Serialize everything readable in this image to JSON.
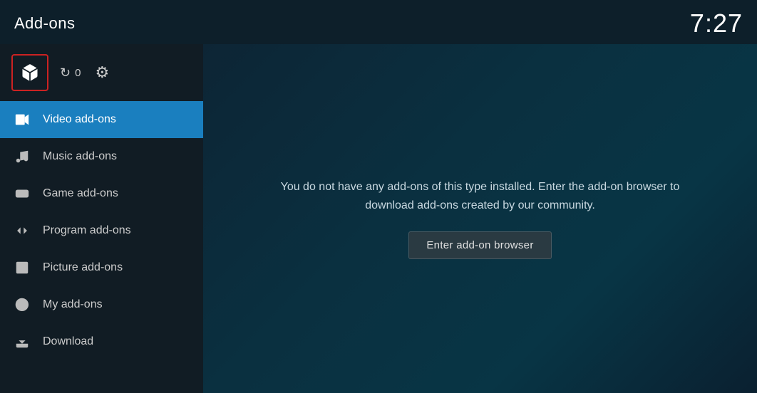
{
  "header": {
    "title": "Add-ons",
    "time": "7:27"
  },
  "toolbar": {
    "update_count": "0"
  },
  "nav": {
    "items": [
      {
        "id": "video-addons",
        "label": "Video add-ons",
        "icon": "video",
        "active": true
      },
      {
        "id": "music-addons",
        "label": "Music add-ons",
        "icon": "music",
        "active": false
      },
      {
        "id": "game-addons",
        "label": "Game add-ons",
        "icon": "game",
        "active": false
      },
      {
        "id": "program-addons",
        "label": "Program add-ons",
        "icon": "program",
        "active": false
      },
      {
        "id": "picture-addons",
        "label": "Picture add-ons",
        "icon": "picture",
        "active": false
      },
      {
        "id": "my-addons",
        "label": "My add-ons",
        "icon": "myaddon",
        "active": false
      },
      {
        "id": "download",
        "label": "Download",
        "icon": "download",
        "active": false
      }
    ]
  },
  "content": {
    "message": "You do not have any add-ons of this type installed. Enter the add-on browser to download add-ons created by our community.",
    "browser_button": "Enter add-on browser"
  }
}
